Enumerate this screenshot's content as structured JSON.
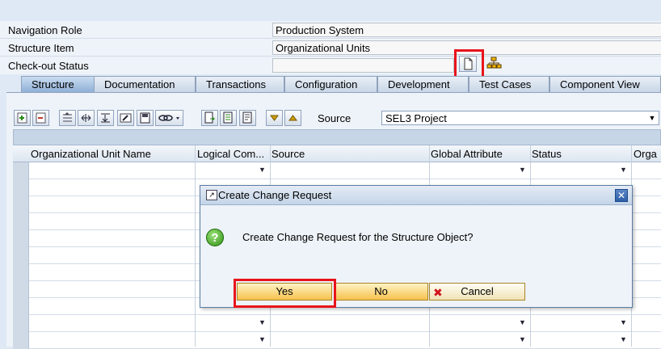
{
  "header": {
    "rows": [
      {
        "label": "Navigation Role",
        "value": "Production System"
      },
      {
        "label": "Structure Item",
        "value": "Organizational Units"
      },
      {
        "label": "Check-out Status",
        "value": ""
      }
    ]
  },
  "tabs": [
    {
      "label": "Structure",
      "active": true
    },
    {
      "label": "Documentation"
    },
    {
      "label": "Transactions"
    },
    {
      "label": "Configuration"
    },
    {
      "label": "Development"
    },
    {
      "label": "Test Cases"
    },
    {
      "label": "Component View"
    }
  ],
  "toolbar": {
    "source_label": "Source",
    "source_value": "SEL3 Project"
  },
  "table": {
    "columns": [
      "Organizational Unit Name",
      "Logical Com...",
      "Source",
      "Global Attribute",
      "Status",
      "Orga"
    ]
  },
  "dialog": {
    "title": "Create Change Request",
    "message": "Create Change Request for the Structure Object?",
    "yes_label": "Yes",
    "no_label": "No",
    "cancel_label": "Cancel"
  },
  "icons": {
    "new_document": "new-document-icon",
    "hierarchy": "hierarchy-icon",
    "question": "question-icon",
    "close": "close-icon"
  },
  "colors": {
    "highlight_red": "#e8141b",
    "button_yellow": "#f6c14e",
    "frame_blue": "#dfe9f5"
  }
}
